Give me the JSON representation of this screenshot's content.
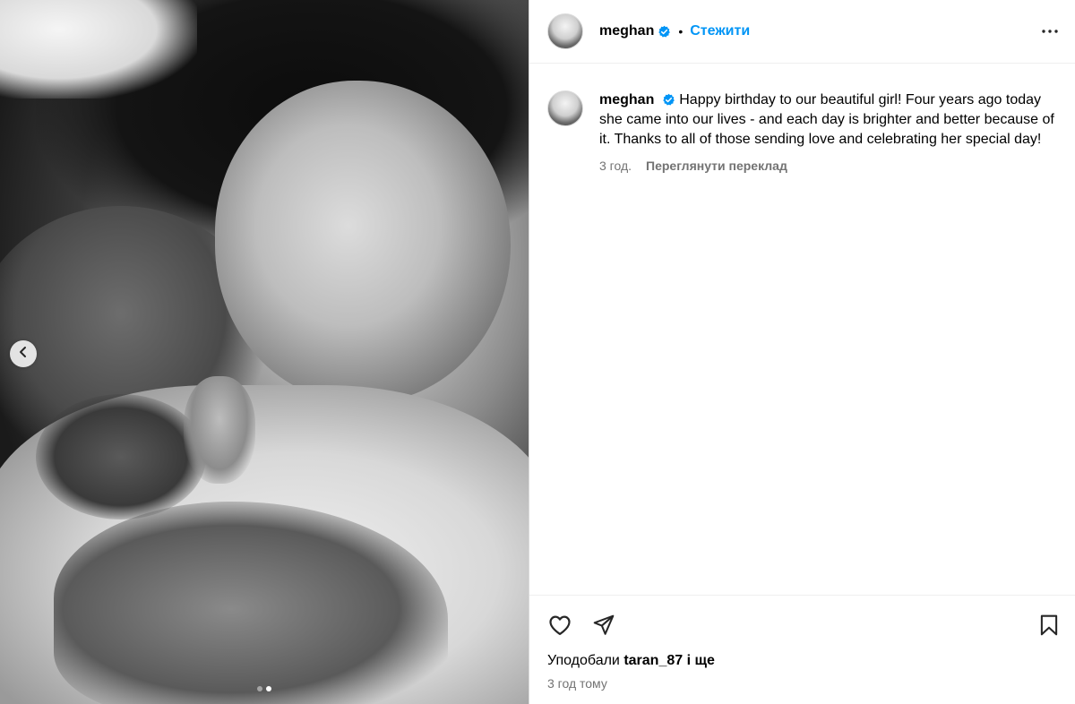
{
  "post": {
    "username": "meghan",
    "follow_label": "Стежити",
    "separator": "•",
    "caption": "Happy birthday to our beautiful girl! Four years ago today she came into our lives - and each day is brighter and better because of it. Thanks to all of those sending love and celebrating her special day!",
    "caption_time": "3 год.",
    "translate_label": "Переглянути переклад",
    "likes_prefix": "Уподобали",
    "likes_user": "taran_87",
    "likes_suffix": "і ще",
    "post_time": "3 год тому"
  },
  "carousel": {
    "slide_count": 2,
    "active_index": 1
  },
  "colors": {
    "accent": "#0095f6",
    "verified": "#0095f6",
    "muted": "#737373",
    "border": "#dbdbdb"
  },
  "icons": [
    "chevron-left-icon",
    "verified-badge-icon",
    "more-options-icon",
    "heart-icon",
    "share-icon",
    "bookmark-icon"
  ]
}
